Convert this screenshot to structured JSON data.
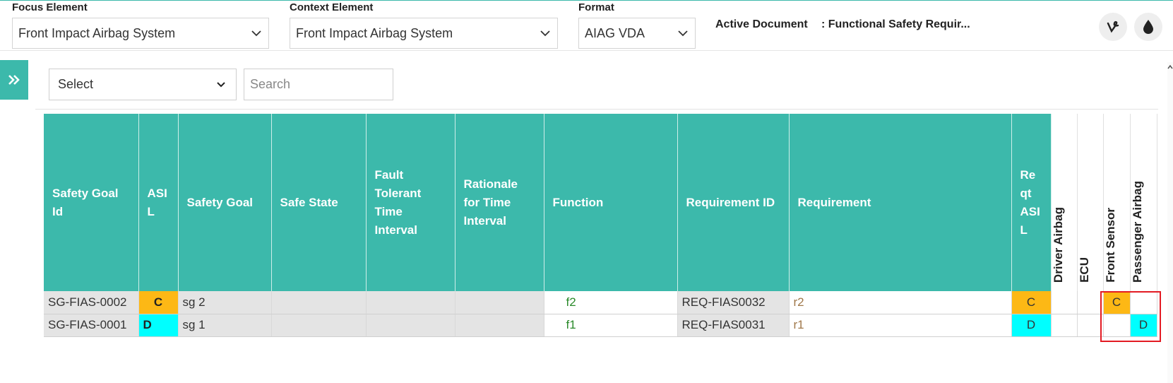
{
  "toolbar": {
    "focus_label": "Focus Element",
    "focus_value": "Front Impact Airbag System",
    "context_label": "Context Element",
    "context_value": "Front Impact Airbag System",
    "format_label": "Format",
    "format_value": "AIAG VDA",
    "active_doc_label": "Active Document",
    "active_doc_value": ": Functional Safety Requir..."
  },
  "filter": {
    "select_value": "Select",
    "search_placeholder": "Search"
  },
  "table": {
    "headers": {
      "sg_id": "Safety Goal Id",
      "asil": "ASI L",
      "safety_goal": "Safety Goal",
      "safe_state": "Safe State",
      "ftti": "Fault Tolerant Time Interval",
      "rationale": "Rationale for Time Interval",
      "function": "Function",
      "req_id": "Requirement ID",
      "requirement": "Requirement",
      "req_asil": "Re qt ASI L",
      "driver_airbag": "Driver Airbag",
      "ecu": "ECU",
      "front_sensor": "Front Sensor",
      "passenger_airbag": "Passenger Airbag"
    },
    "rows": [
      {
        "sg_id": "SG-FIAS-0002",
        "asil": "C",
        "safety_goal": "sg 2",
        "function": "f2",
        "req_id": "REQ-FIAS0032",
        "requirement": "r2",
        "req_asil": "C",
        "front_sensor": "C",
        "passenger_airbag": ""
      },
      {
        "sg_id": "SG-FIAS-0001",
        "asil": "D",
        "safety_goal": "sg 1",
        "function": "f1",
        "req_id": "REQ-FIAS0031",
        "requirement": "r1",
        "req_asil": "D",
        "front_sensor": "",
        "passenger_airbag": "D"
      }
    ]
  },
  "colors": {
    "accent": "#3cb9ab",
    "asil_c": "#fdb815",
    "asil_d": "#00ffff",
    "highlight": "#e31b23"
  }
}
